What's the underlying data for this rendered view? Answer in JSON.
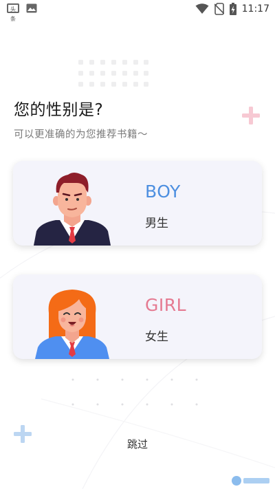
{
  "status_bar": {
    "time": "11:17",
    "left_icons": [
      "news-app-icon",
      "image-icon"
    ],
    "right_icons": [
      "wifi-icon",
      "no-sim-icon",
      "battery-charging-icon"
    ],
    "news_icon_text": "头条"
  },
  "header": {
    "title": "您的性别是?",
    "subtitle": "可以更准确的为您推荐书籍～"
  },
  "options": {
    "boy": {
      "en": "BOY",
      "cn": "男生"
    },
    "girl": {
      "en": "GIRL",
      "cn": "女生"
    }
  },
  "skip_label": "跳过",
  "colors": {
    "boy_accent": "#4d8fe0",
    "girl_accent": "#e57a91",
    "card_bg": "#f4f4fb",
    "plus_pink": "#f7c9d3",
    "plus_blue": "#bcd6f2"
  }
}
